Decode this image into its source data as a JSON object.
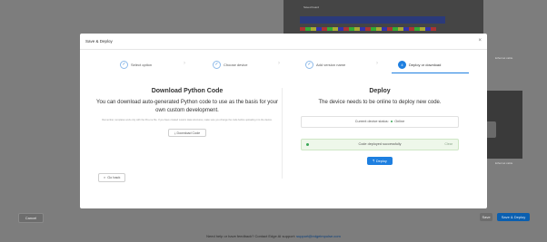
{
  "background": {
    "photo_label": "Saved board",
    "side_label_top": "Ethernet cable",
    "side_label_mid": "Ethernet cable",
    "cancel_label": "Cancel",
    "save_label": "Save",
    "save_deploy_label": "Save & Deploy",
    "footer_text": "Need help or have feedback? Contact Edge AI support: ",
    "footer_link": "support@edgeimpulse.com"
  },
  "modal": {
    "title": "Save & Deploy",
    "close_icon": "close-icon",
    "steps": [
      {
        "label": "Select option",
        "state": "done",
        "icon": "check-icon"
      },
      {
        "label": "Choose device",
        "state": "done",
        "icon": "check-icon"
      },
      {
        "label": "Add version name",
        "state": "done",
        "icon": "check-icon"
      },
      {
        "label": "Deploy or download",
        "number": "4",
        "state": "active"
      }
    ],
    "left": {
      "title": "Download Python Code",
      "subtitle": "You can download auto-generated Python code to use as the basis for your own custom development.",
      "fine_print": "Remember, templates work only with the Pre-me fhe. If you have created custom data structures, make sure you change the code before uploading it to the device.",
      "download_label": "Download Code",
      "download_icon": "download-icon"
    },
    "right": {
      "title": "Deploy",
      "subtitle": "The device needs to be online to deploy new code.",
      "status_label": "Current device status:",
      "status_value": "Online",
      "success_message": "Code deployed successfully",
      "clear_label": "Clear",
      "deploy_label": "Deploy",
      "deploy_icon": "upload-icon"
    },
    "go_back_label": "Go back"
  },
  "colors": {
    "accent": "#1e7fe0",
    "success": "#3aa757",
    "overlay": "#7d7d7d"
  }
}
